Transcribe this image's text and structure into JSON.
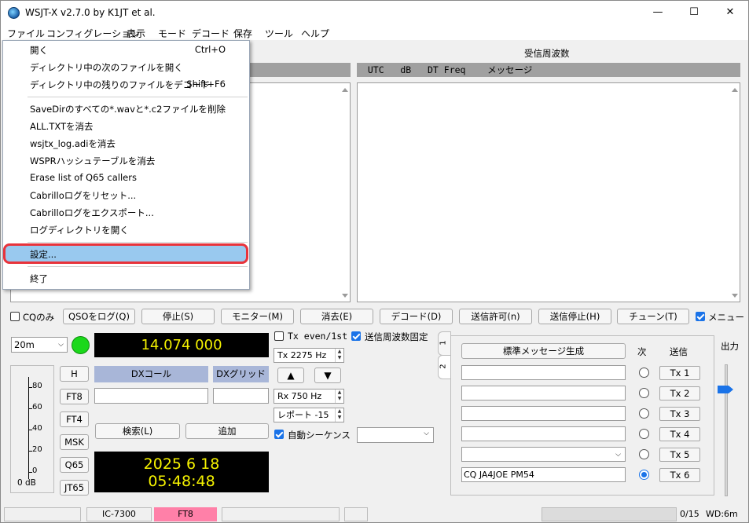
{
  "window": {
    "title": "WSJT-X   v2.7.0   by K1JT et al.",
    "minimize": "—",
    "maximize": "☐",
    "close": "✕"
  },
  "menubar": [
    "ファイル",
    "コンフィグレーション",
    "表示",
    "モード",
    "デコード",
    "保存",
    "ツール",
    "ヘルプ"
  ],
  "file_menu": {
    "items": [
      {
        "label": "開く",
        "shortcut": "Ctrl+O"
      },
      {
        "label": "ディレクトリ中の次のファイルを開く",
        "shortcut": ""
      },
      {
        "label": "ディレクトリ中の残りのファイルをデコード",
        "shortcut": "Shift+F6"
      },
      {
        "label": "SaveDirのすべての*.wavと*.c2ファイルを削除",
        "shortcut": ""
      },
      {
        "label": "ALL.TXTを消去",
        "shortcut": ""
      },
      {
        "label": "wsjtx_log.adiを消去",
        "shortcut": ""
      },
      {
        "label": "WSPRハッシュテーブルを消去",
        "shortcut": ""
      },
      {
        "label": "Erase list of Q65 callers",
        "shortcut": ""
      },
      {
        "label": "Cabrilloログをリセット...",
        "shortcut": ""
      },
      {
        "label": "Cabrilloログをエクスポート...",
        "shortcut": ""
      },
      {
        "label": "ログディレクトリを開く",
        "shortcut": ""
      },
      {
        "label": "設定...",
        "shortcut": ""
      },
      {
        "label": "終了",
        "shortcut": ""
      }
    ]
  },
  "rx_panel": {
    "title": "受信周波数",
    "header": "  UTC   dB   DT Freq    メッセージ"
  },
  "buttons": {
    "cq_only": "CQのみ",
    "log_qso": "QSOをログ(Q)",
    "stop": "停止(S)",
    "monitor": "モニター(M)",
    "erase": "消去(E)",
    "decode": "デコード(D)",
    "enable_tx": "送信許可(n)",
    "halt_tx": "送信停止(H)",
    "tune": "チューン(T)",
    "menus": "メニュー"
  },
  "band": "20m",
  "frequency": "14.074 000",
  "mode_buttons": [
    "H",
    "FT8",
    "FT4",
    "MSK",
    "Q65",
    "JT65"
  ],
  "meter": {
    "ticks": [
      "80",
      "60",
      "40",
      "20",
      "0"
    ],
    "unit": "0 dB"
  },
  "dx": {
    "call_label": "DXコール",
    "grid_label": "DXグリッド",
    "search": "検索(L)",
    "add": "追加"
  },
  "clock": {
    "date": "2025 6 18",
    "time": "05:48:48"
  },
  "tx_controls": {
    "tx_even": "Tx even/1st",
    "hold_tx_freq": "送信周波数固定",
    "tx_freq": "Tx  2275  Hz",
    "rx_freq": "Rx  750  Hz",
    "report": "レポート -15",
    "auto_seq": "自動シーケンス",
    "up": "▲",
    "down": "▼"
  },
  "messages": {
    "generate": "標準メッセージ生成",
    "next": "次",
    "send": "送信",
    "tx_labels": [
      "Tx 1",
      "Tx 2",
      "Tx 3",
      "Tx 4",
      "Tx 5",
      "Tx 6"
    ],
    "tx6_text": "CQ JA4JOE PM54",
    "tab1": "1",
    "tab2": "2"
  },
  "power_label": "出力",
  "status": {
    "rig": "IC-7300",
    "mode": "FT8",
    "count": "0/15",
    "wd": "WD:6m"
  },
  "colors": {
    "highlight": "#99c9ef",
    "annotation": "#e8333b",
    "mode_badge": "#ff80a8",
    "digits": "#f5f200"
  }
}
